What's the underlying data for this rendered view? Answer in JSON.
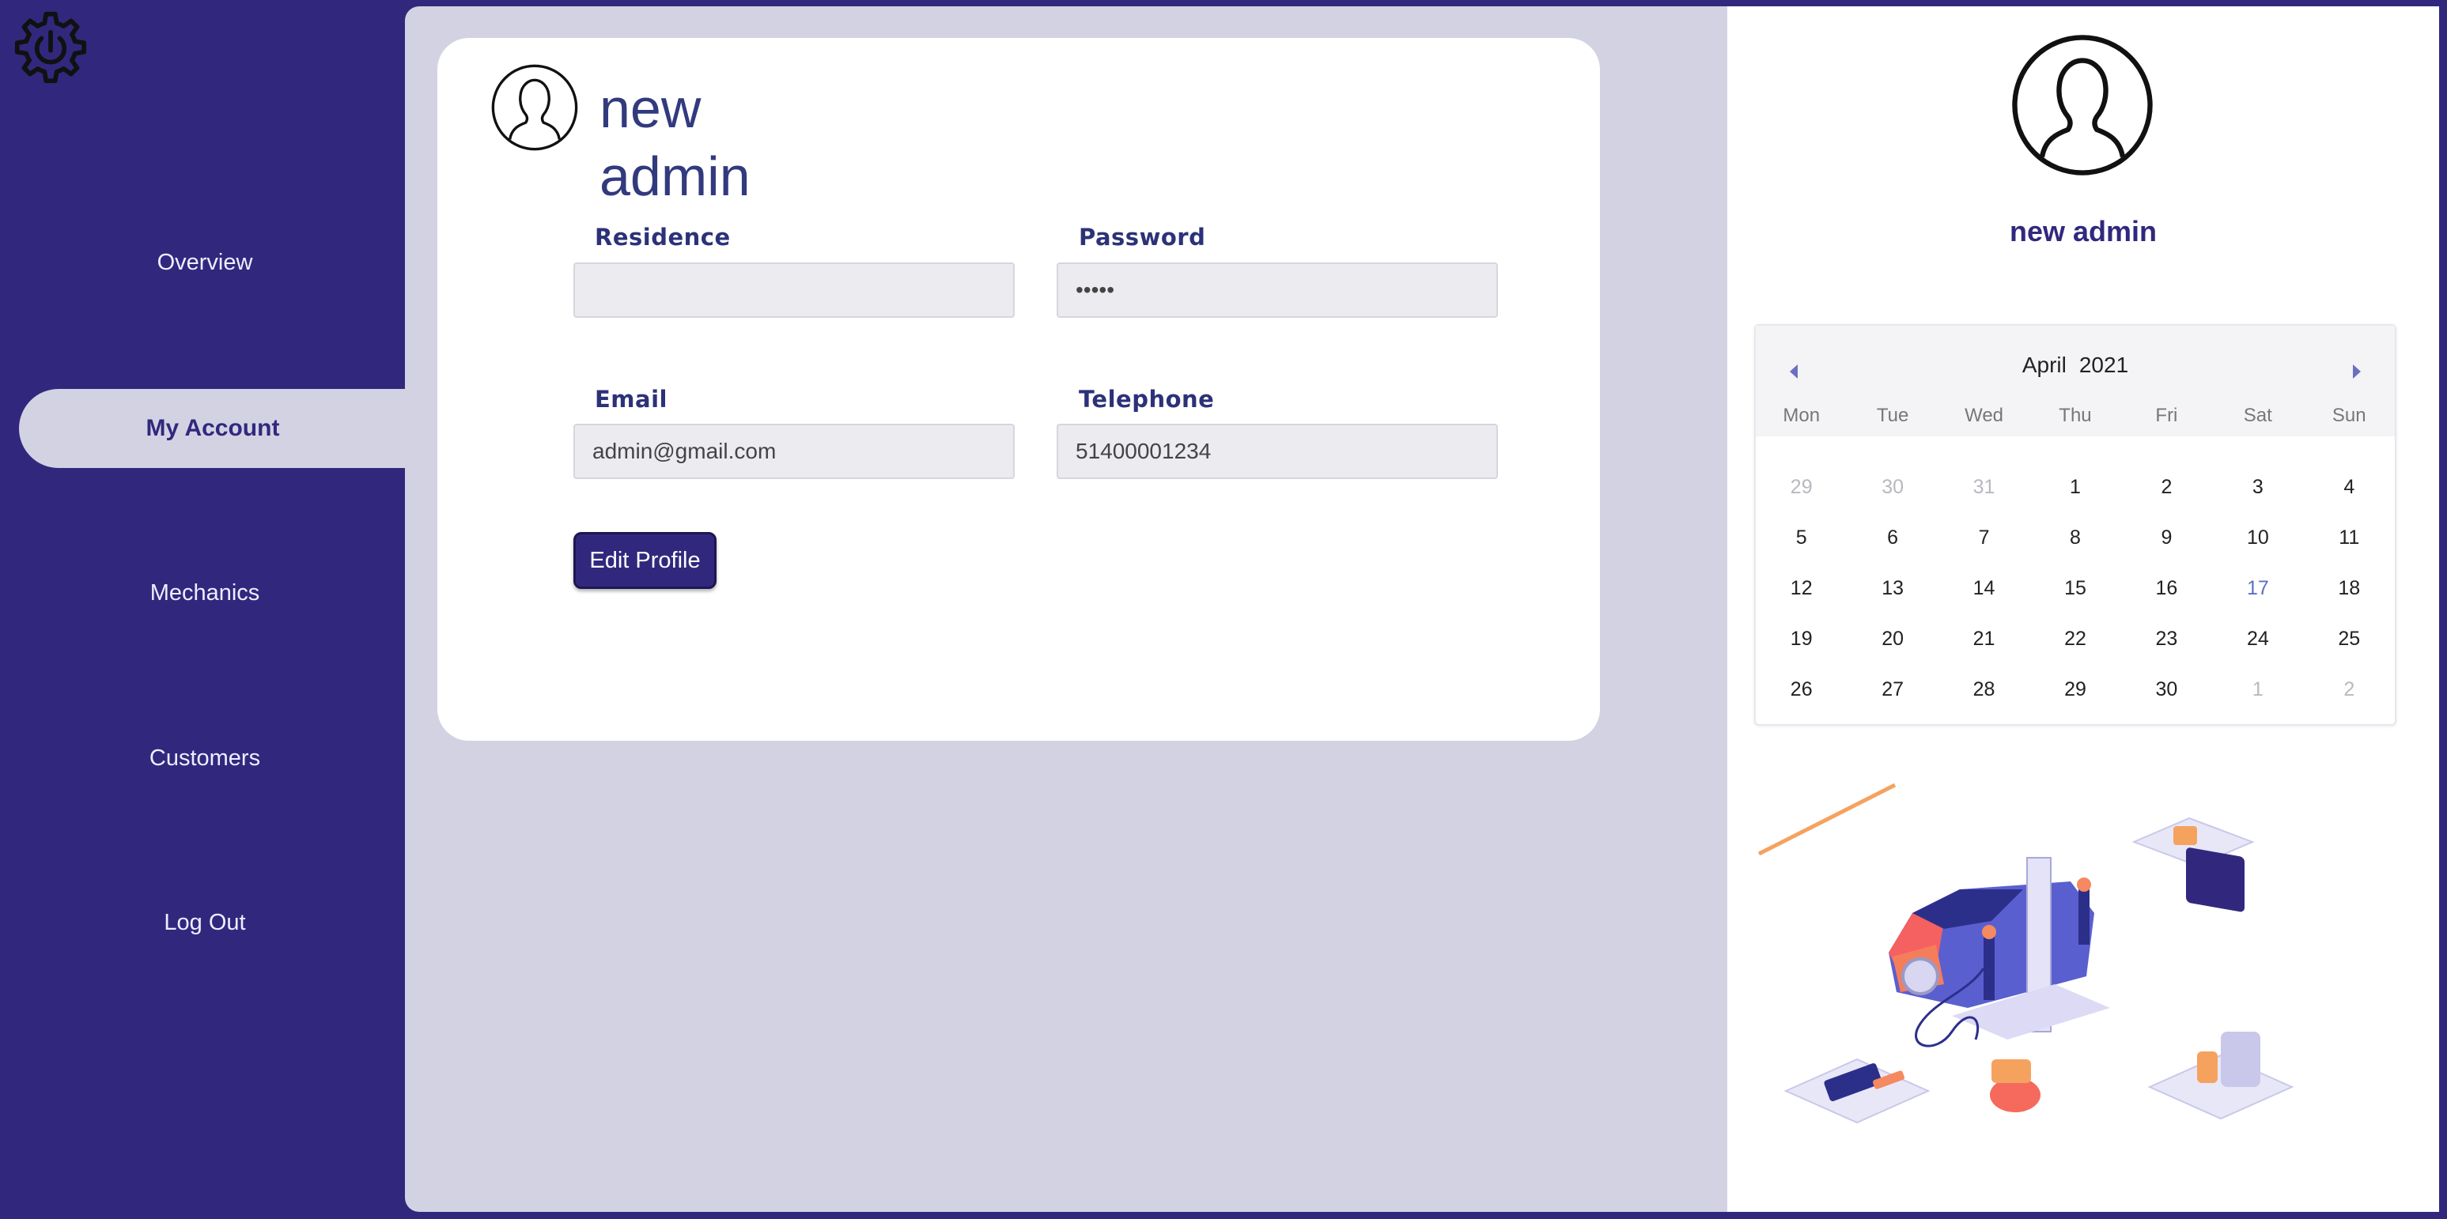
{
  "sidebar": {
    "logo_icon": "gear-power-icon",
    "items": [
      {
        "label": "Overview"
      },
      {
        "label": "My Account"
      },
      {
        "label": "Mechanics"
      },
      {
        "label": "Customers"
      },
      {
        "label": "Log Out"
      }
    ],
    "active_item": "My Account"
  },
  "card": {
    "avatar_icon": "user-avatar-icon",
    "name_line1": "new",
    "name_line2": "admin",
    "fields": {
      "residence": {
        "label": "Residence",
        "value": ""
      },
      "password": {
        "label": "Password",
        "value": "•••••"
      },
      "email": {
        "label": "Email",
        "value": "admin@gmail.com"
      },
      "telephone": {
        "label": "Telephone",
        "value": "51400001234"
      }
    },
    "edit_button_label": "Edit Profile"
  },
  "profile": {
    "avatar_icon": "user-avatar-icon",
    "name": "new admin"
  },
  "calendar": {
    "month": "April",
    "year": "2021",
    "weekdays": [
      "Mon",
      "Tue",
      "Wed",
      "Thu",
      "Fri",
      "Sat",
      "Sun"
    ],
    "days": [
      {
        "d": "29",
        "muted": true
      },
      {
        "d": "30",
        "muted": true
      },
      {
        "d": "31",
        "muted": true
      },
      {
        "d": "1"
      },
      {
        "d": "2"
      },
      {
        "d": "3"
      },
      {
        "d": "4"
      },
      {
        "d": "5"
      },
      {
        "d": "6"
      },
      {
        "d": "7"
      },
      {
        "d": "8"
      },
      {
        "d": "9"
      },
      {
        "d": "10"
      },
      {
        "d": "11"
      },
      {
        "d": "12"
      },
      {
        "d": "13"
      },
      {
        "d": "14"
      },
      {
        "d": "15"
      },
      {
        "d": "16"
      },
      {
        "d": "17",
        "today": true
      },
      {
        "d": "18"
      },
      {
        "d": "19"
      },
      {
        "d": "20"
      },
      {
        "d": "21"
      },
      {
        "d": "22"
      },
      {
        "d": "23"
      },
      {
        "d": "24"
      },
      {
        "d": "25"
      },
      {
        "d": "26"
      },
      {
        "d": "27"
      },
      {
        "d": "28"
      },
      {
        "d": "29"
      },
      {
        "d": "30"
      },
      {
        "d": "1",
        "muted": true
      },
      {
        "d": "2",
        "muted": true
      }
    ]
  },
  "illustration": {
    "icon": "car-repair-illustration"
  },
  "colors": {
    "brand": "#31287e",
    "background": "#d3d2e2",
    "heading": "#323a7e",
    "accent_today": "#5a70c6",
    "illustration_orange": "#f5895f"
  }
}
